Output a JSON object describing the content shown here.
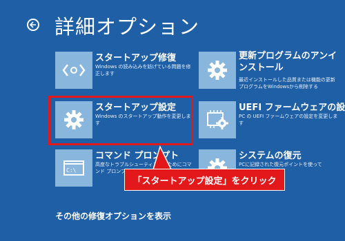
{
  "header": {
    "title": "詳細オプション",
    "back_icon": "back-arrow-icon"
  },
  "tiles": [
    {
      "title": "スタートアップ修復",
      "desc": "Windows の読み込みを妨げている問題を修正します",
      "icon": "code-brackets-icon"
    },
    {
      "title": "更新プログラムのアンインストール",
      "desc": "最近インストールした品質または機能の更新プログラムをWindowsから削除する",
      "icon": "gear-icon"
    },
    {
      "title": "スタートアップ設定",
      "desc": "Windows のスタートアップ動作を変更します",
      "icon": "gear-icon"
    },
    {
      "title": "UEFI ファームウェアの設定",
      "desc": "PC の UEFI ファームウェアの設定を変更します",
      "icon": "chip-gear-icon"
    },
    {
      "title": "コマンド プロンプト",
      "desc": "高度なトラブルシューティングのためにコマンド プロンプトを使用します",
      "icon": "command-prompt-icon"
    },
    {
      "title": "システムの復元",
      "desc": "PCに記録された復元ポイントを使って",
      "icon": "gear-icon"
    }
  ],
  "callout": {
    "text": "「スタートアップ設定」をクリック"
  },
  "footer": {
    "more_options": "その他の修復オプションを表示"
  },
  "colors": {
    "background": "#1e5fa6",
    "tile_icon_bg": "#88b6dd",
    "highlight": "#e3181b"
  }
}
